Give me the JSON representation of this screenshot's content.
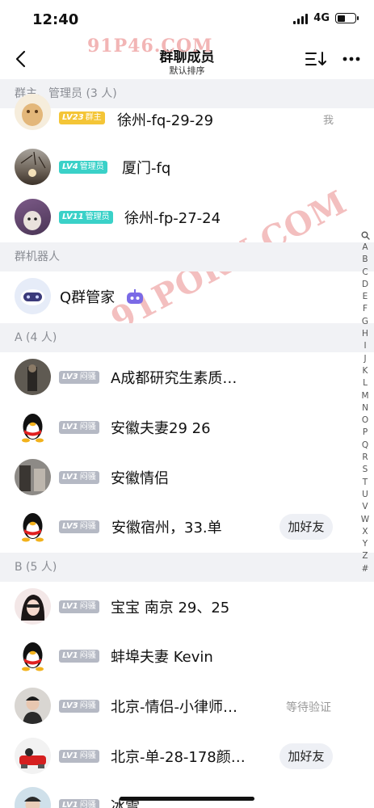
{
  "status": {
    "time": "12:40",
    "network": "4G"
  },
  "nav": {
    "title": "群聊成员",
    "subtitle": "默认排序"
  },
  "watermarks": [
    "91P46.COM",
    "91PORN.COM"
  ],
  "sections": [
    {
      "label": "群主、管理员 (3 人)"
    },
    {
      "label": "群机器人"
    },
    {
      "label": "A (4 人)"
    },
    {
      "label": "B (5 人)"
    }
  ],
  "members": [
    {
      "level": "LV23",
      "role": "群主",
      "name": "徐州-fq-29-29",
      "action": "我"
    },
    {
      "level": "LV4",
      "role": "管理员",
      "name": "厦门-fq",
      "action": ""
    },
    {
      "level": "LV11",
      "role": "管理员",
      "name": "徐州-fp-27-24",
      "action": ""
    },
    {
      "level": "",
      "role": "",
      "name": "Q群管家",
      "action": ""
    },
    {
      "level": "LV3",
      "role": "闷骚",
      "name": "A成都研究生素质…",
      "action": ""
    },
    {
      "level": "LV1",
      "role": "闷骚",
      "name": "安徽夫妻29  26",
      "action": ""
    },
    {
      "level": "LV1",
      "role": "闷骚",
      "name": "安徽情侣",
      "action": ""
    },
    {
      "level": "LV5",
      "role": "闷骚",
      "name": "安徽宿州，33.单",
      "action": "加好友"
    },
    {
      "level": "LV1",
      "role": "闷骚",
      "name": "宝宝 南京 29、25",
      "action": ""
    },
    {
      "level": "LV1",
      "role": "闷骚",
      "name": "蚌埠夫妻 Kevin",
      "action": ""
    },
    {
      "level": "LV3",
      "role": "闷骚",
      "name": "北京-情侣-小律师…",
      "action": "等待验证"
    },
    {
      "level": "LV1",
      "role": "闷骚",
      "name": "北京-单-28-178颜…",
      "action": "加好友"
    },
    {
      "level": "LV1",
      "role": "闷骚",
      "name": "冰雪",
      "action": ""
    }
  ],
  "index_letters": [
    "A",
    "B",
    "C",
    "D",
    "E",
    "F",
    "G",
    "H",
    "I",
    "J",
    "K",
    "L",
    "M",
    "N",
    "O",
    "P",
    "Q",
    "R",
    "S",
    "T",
    "U",
    "V",
    "W",
    "X",
    "Y",
    "Z",
    "#"
  ],
  "colors": {
    "gold": "#f4c537",
    "teal": "#3ad1c8",
    "gray": "#b5b9c4",
    "section_bg": "#f1f2f5"
  }
}
